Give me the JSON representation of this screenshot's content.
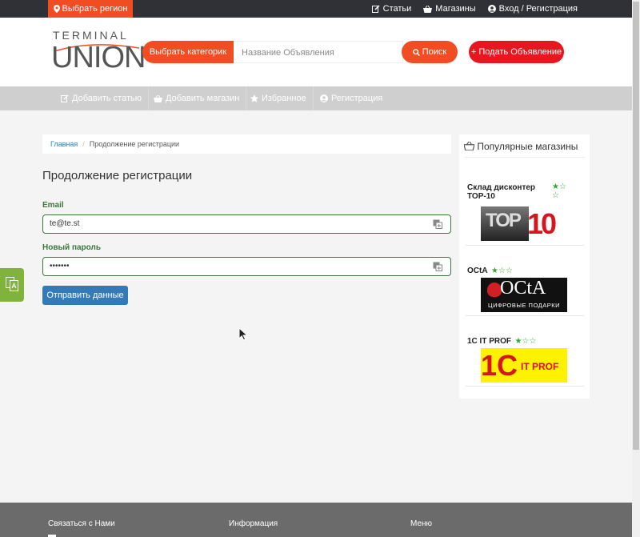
{
  "topbar": {
    "region_label": "Выбрать регион",
    "links": [
      {
        "icon": "edit-icon",
        "label": "Статьи"
      },
      {
        "icon": "basket-icon",
        "label": "Магазины"
      },
      {
        "icon": "user-icon",
        "label": "Вход / Регистрация"
      }
    ]
  },
  "header": {
    "logo_top": "TERMINAL",
    "logo_main": "UNION",
    "category_label": "Выбрать категорик",
    "search_placeholder": "Название Объявления",
    "search_label": "Поиск",
    "post_label": "+ Подать Объявление"
  },
  "nav": {
    "items": [
      {
        "icon": "edit-icon",
        "label": "Добавить статью"
      },
      {
        "icon": "basket-icon",
        "label": "Добавить магазин"
      },
      {
        "icon": "star-icon",
        "label": "Избранное"
      },
      {
        "icon": "user-circle-icon",
        "label": "Регистрация"
      }
    ]
  },
  "breadcrumb": {
    "home": "Главная",
    "separator": "/",
    "current": "Продолжение регистрации"
  },
  "main": {
    "title": "Продолжение регистрации",
    "email_label": "Email",
    "email_value": "te@te.st",
    "password_label": "Новый пароль",
    "password_value": "•••••••",
    "submit_label": "Отправить данные"
  },
  "sidebar": {
    "title": "Популярные магазины",
    "shops": [
      {
        "name": "Склад дисконтер TOP-10",
        "rating": 3,
        "logo_text": "TOP 10"
      },
      {
        "name": "OCtA",
        "rating": 3,
        "logo_text": "OCtA",
        "logo_sub": "ЦИФРОВЫЕ ПОДАРКИ"
      },
      {
        "name": "1C IT PROF",
        "rating": 3,
        "logo_text": "1C IT PROF"
      }
    ]
  },
  "footer": {
    "col1": "Связаться с Нами",
    "col2": "Информация",
    "col3": "Меню"
  },
  "colors": {
    "accent": "#f04d23",
    "post": "#e8161e",
    "primary": "#337ab7",
    "success": "#3c763d",
    "star": "#38a43a"
  }
}
